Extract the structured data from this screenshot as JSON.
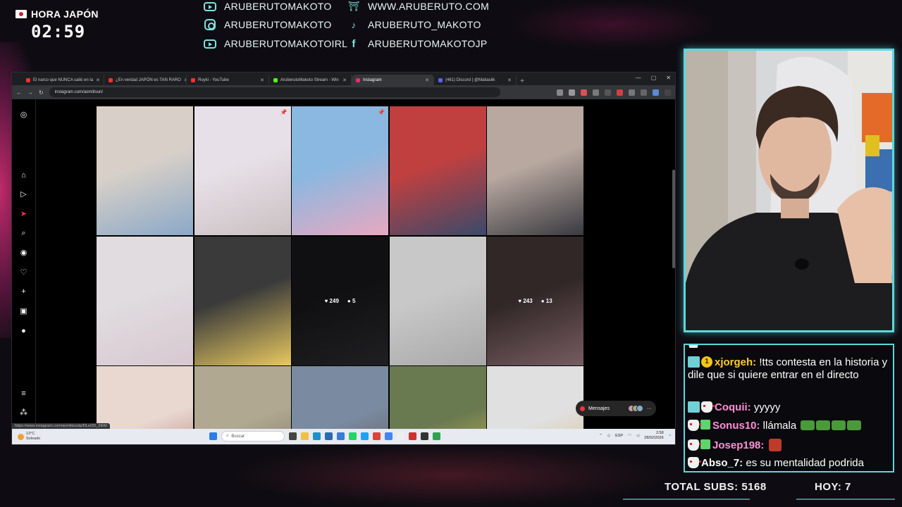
{
  "clock": {
    "label": "HORA JAPÓN",
    "time": "02:59"
  },
  "socials": {
    "left": [
      {
        "icon": "youtube-icon",
        "handle": "ARUBERUTOMAKOTO"
      },
      {
        "icon": "instagram-icon",
        "handle": "ARUBERUTOMAKOTO"
      },
      {
        "icon": "youtube-icon",
        "handle": "ARUBERUTOMAKOTOIRL"
      }
    ],
    "right": [
      {
        "icon": "torii-gate-icon",
        "handle": "WWW.ARUBERUTO.COM"
      },
      {
        "icon": "tiktok-icon",
        "handle": "ARUBERUTO_MAKOTO"
      },
      {
        "icon": "facebook-icon",
        "handle": "ARUBERUTOMAKOTOJP"
      }
    ]
  },
  "browser": {
    "tabs": [
      {
        "title": "El narco que NUNCA salió en la",
        "color": "#ff3030"
      },
      {
        "title": "¿En verdad JAPÓN es TAN RARO",
        "color": "#ff3030"
      },
      {
        "title": "Royki - YouTube",
        "color": "#ff3030"
      },
      {
        "title": "AruberutoMakoto Stream - Win",
        "color": "#53fc18"
      },
      {
        "title": "Instagram",
        "color": "#e1306c"
      },
      {
        "title": "(461) Discord | @Matiaslik",
        "color": "#5865f2"
      }
    ],
    "url": "instagram.com/aomiitsun/",
    "status_url": "https://www.instagram.com/aomiitsun/p/DLeOD_2tkN/"
  },
  "instagram": {
    "posts": [
      {
        "likes": "",
        "comments": ""
      },
      {
        "likes": "",
        "comments": ""
      },
      {
        "likes": "",
        "comments": ""
      },
      {
        "likes": "",
        "comments": ""
      },
      {
        "likes": "",
        "comments": ""
      },
      {
        "likes": "",
        "comments": ""
      },
      {
        "likes": "",
        "comments": ""
      },
      {
        "likes": "249",
        "comments": "5"
      },
      {
        "likes": "",
        "comments": ""
      },
      {
        "likes": "243",
        "comments": "13"
      },
      {
        "likes": "",
        "comments": ""
      },
      {
        "likes": "",
        "comments": ""
      },
      {
        "likes": "",
        "comments": ""
      },
      {
        "likes": "",
        "comments": ""
      },
      {
        "likes": "",
        "comments": ""
      }
    ],
    "messages_label": "Mensajes"
  },
  "taskbar": {
    "weather_temp": "13°C",
    "weather_desc": "Soleado",
    "search_placeholder": "Buscar",
    "lang": "ESP",
    "time": "2:58",
    "date": "28/02/2026"
  },
  "chat": {
    "messages": [
      {
        "user": "xjorgeh:",
        "user_color": "#ffcc33",
        "text": " !tts contesta en la historia y dile que si quiere entrar en el directo"
      },
      {
        "user": "Coquii:",
        "user_color": "#ff8fd6",
        "text": " yyyyy"
      },
      {
        "user": "Sonus10:",
        "user_color": "#ff8fd6",
        "text": " llámala"
      },
      {
        "user": "Josep198:",
        "user_color": "#ff8fd6",
        "text": ""
      },
      {
        "user": "Abso_7:",
        "user_color": "#ffffff",
        "text": " es su mentalidad podrida"
      }
    ]
  },
  "stats": {
    "total_subs": "TOTAL SUBS: 5168",
    "today": "HOY: 7"
  },
  "colors": {
    "accent": "#5ad8dc",
    "instagram_bg": "#000000",
    "background": "#0e0c12"
  }
}
